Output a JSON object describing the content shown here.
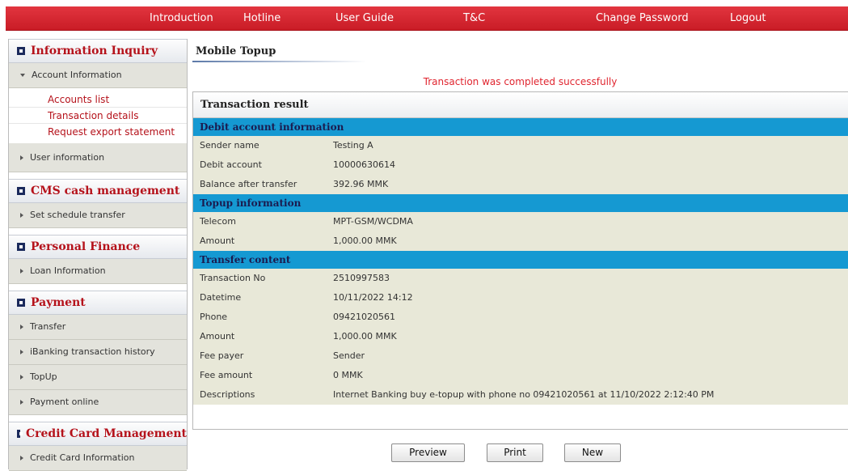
{
  "nav": {
    "introduction": "Introduction",
    "hotline": "Hotline",
    "user_guide": "User Guide",
    "tc": "T&C",
    "change_password": "Change Password",
    "logout": "Logout"
  },
  "sidebar": {
    "info_inquiry": {
      "title": "Information Inquiry",
      "account_information": "Account Information",
      "links": [
        "Accounts list",
        "Transaction details",
        "Request export statement"
      ],
      "user_information": "User information"
    },
    "cms": {
      "title": "CMS cash management",
      "items": [
        "Set schedule transfer"
      ]
    },
    "personal_finance": {
      "title": "Personal Finance",
      "items": [
        "Loan Information"
      ]
    },
    "payment": {
      "title": "Payment",
      "items": [
        "Transfer",
        "iBanking transaction history",
        "TopUp",
        "Payment online"
      ]
    },
    "credit_card": {
      "title": "Credit Card Management",
      "items": [
        "Credit Card Information"
      ]
    }
  },
  "main": {
    "title": "Mobile Topup",
    "success_message": "Transaction was completed successfully",
    "result_title": "Transaction result",
    "debit_section": {
      "title": "Debit account information",
      "rows": [
        {
          "label": "Sender name",
          "value": "Testing A"
        },
        {
          "label": "Debit account",
          "value": "10000630614"
        },
        {
          "label": "Balance after transfer",
          "value": "392.96 MMK"
        }
      ]
    },
    "topup_section": {
      "title": "Topup information",
      "rows": [
        {
          "label": "Telecom",
          "value": "MPT-GSM/WCDMA"
        },
        {
          "label": "Amount",
          "value": "1,000.00 MMK"
        }
      ]
    },
    "transfer_section": {
      "title": "Transfer content",
      "rows": [
        {
          "label": "Transaction No",
          "value": "2510997583"
        },
        {
          "label": "Datetime",
          "value": "10/11/2022 14:12"
        },
        {
          "label": "Phone",
          "value": "09421020561"
        },
        {
          "label": "Amount",
          "value": "1,000.00  MMK"
        },
        {
          "label": "Fee payer",
          "value": "Sender"
        },
        {
          "label": "Fee amount",
          "value": "0  MMK"
        },
        {
          "label": "Descriptions",
          "value": "Internet Banking buy e-topup with phone no 09421020561 at 11/10/2022 2:12:40 PM"
        }
      ]
    },
    "buttons": {
      "preview": "Preview",
      "print": "Print",
      "new": "New"
    }
  },
  "colors": {
    "nav_red": "#d42630",
    "section_blue": "#1599d2",
    "row_bg": "#e8e8d8",
    "link_red": "#b5121b"
  }
}
